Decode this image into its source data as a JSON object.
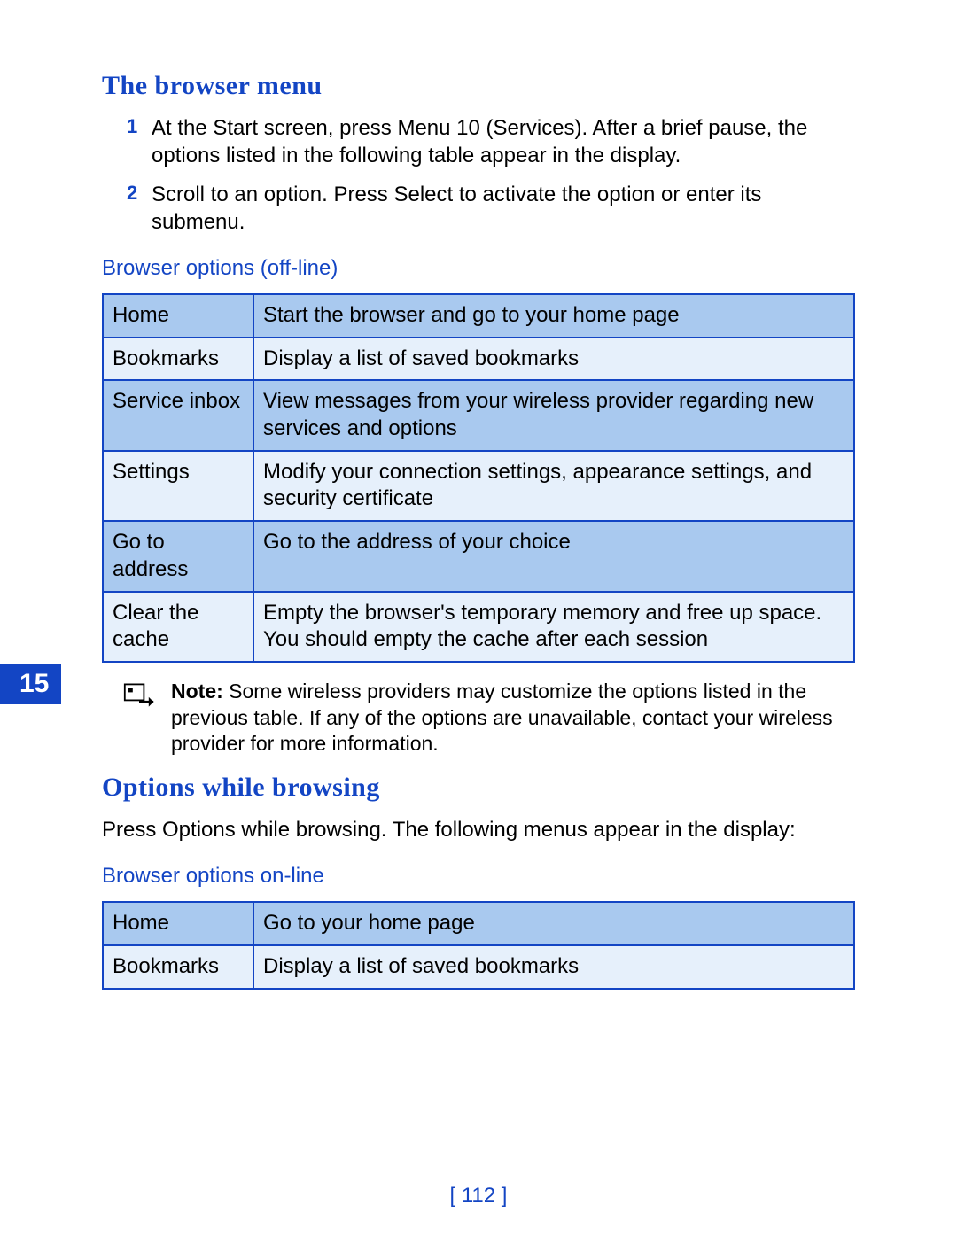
{
  "side_tab": "15",
  "page_number": "[ 112 ]",
  "section1": {
    "heading": "The browser menu",
    "steps": [
      {
        "num": "1",
        "text": "At the Start screen, press Menu 10 (Services). After a brief pause, the options listed in the following table appear in the display."
      },
      {
        "num": "2",
        "text": "Scroll to an option. Press Select to activate the option or enter its submenu."
      }
    ],
    "table_caption": "Browser options (off-line)",
    "rows": [
      {
        "label": "Home",
        "desc": "Start the browser and go to your home page"
      },
      {
        "label": "Bookmarks",
        "desc": "Display a list of saved bookmarks"
      },
      {
        "label": "Service inbox",
        "desc": "View messages from your wireless provider regarding new services and options"
      },
      {
        "label": "Settings",
        "desc": "Modify your connection settings, appearance settings, and security certificate"
      },
      {
        "label": "Go to address",
        "desc": "Go to the address of your choice"
      },
      {
        "label": "Clear the cache",
        "desc": "Empty the browser's temporary memory and free up space. You should empty the cache after each session"
      }
    ],
    "note_label": "Note: ",
    "note_text": "Some wireless providers may customize the options listed in the previous table. If any of the options are unavailable, contact your wireless provider for more information."
  },
  "section2": {
    "heading": "Options while browsing",
    "paragraph": "Press Options while browsing. The following menus appear in the display:",
    "table_caption": "Browser options on-line",
    "rows": [
      {
        "label": "Home",
        "desc": "Go to your home page"
      },
      {
        "label": "Bookmarks",
        "desc": "Display a list of saved bookmarks"
      }
    ]
  }
}
